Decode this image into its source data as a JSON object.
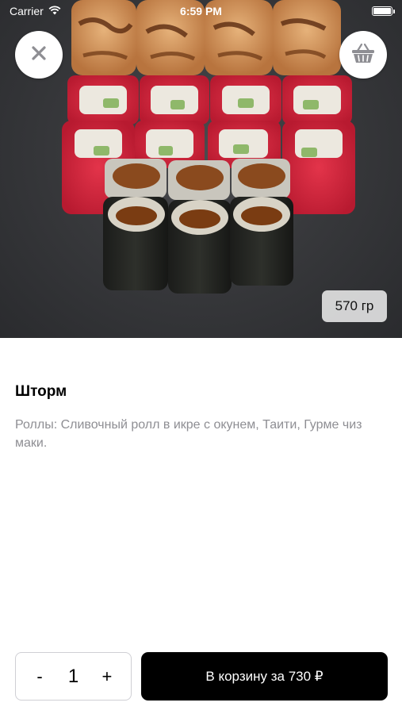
{
  "status_bar": {
    "carrier": "Carrier",
    "time": "6:59 PM"
  },
  "icons": {
    "close": "close-icon",
    "basket": "basket-icon",
    "wifi": "wifi-icon",
    "battery": "battery-icon"
  },
  "product": {
    "weight": "570 гр",
    "title": "Шторм",
    "description": "Роллы: Сливочный ролл в икре с окунем, Таити, Гурме чиз маки."
  },
  "quantity": {
    "minus_label": "-",
    "value": "1",
    "plus_label": "+"
  },
  "cart_button": {
    "label": "В корзину за 730 ₽"
  },
  "colors": {
    "accent": "#000000",
    "secondary_text": "#8e8e93",
    "basket_icon": "#8e8e93"
  }
}
